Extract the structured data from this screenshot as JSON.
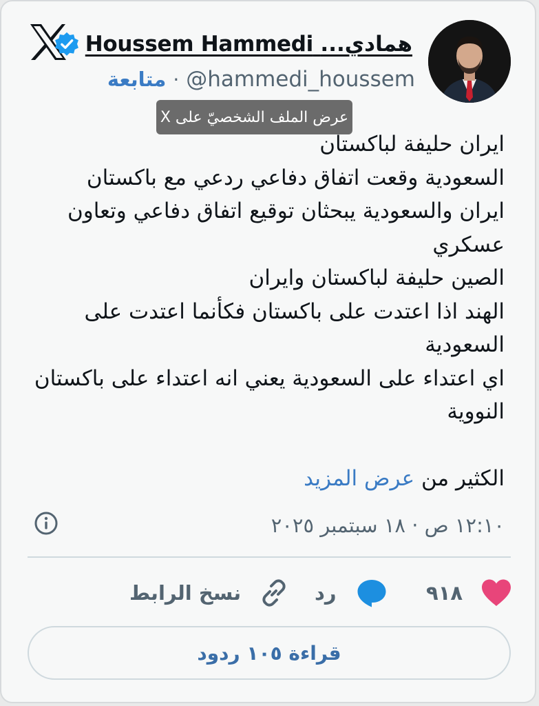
{
  "author": {
    "display_name": "Houssem Hammedi",
    "name_suffix": "همادي...",
    "handle": "@hammedi_houssem",
    "follow_label": "متابعة",
    "separator": "·",
    "verified": true
  },
  "tooltip": {
    "text": "عرض الملف الشخصيّ على X"
  },
  "tweet": {
    "lines": [
      "ايران حليفة لباكستان",
      "السعودية وقعت اتفاق دفاعي ردعي مع باكستان",
      "ايران والسعودية يبحثان توقيع اتفاق دفاعي وتعاون",
      "عسكري",
      "الصين حليفة لباكستان وايران",
      "الهند اذا اعتدت على باكستان فكأنما اعتدت على",
      "السعودية",
      "اي اعتداء على السعودية يعني انه اعتداء على باكستان",
      "النووية"
    ],
    "more_prefix": "الكثير من",
    "more_link": "عرض المزيد",
    "timestamp": "١٢:١٠ ص · ١٨ سبتمبر ٢٠٢٥"
  },
  "actions": {
    "like_count": "٩١٨",
    "reply_label": "رد",
    "copy_link_label": "نسخ الرابط"
  },
  "read_replies_label": "قراءة ١٠٥ ردود",
  "icons": {
    "logo": "x-logo-icon",
    "verified": "verified-badge-icon",
    "info": "info-icon",
    "like": "heart-icon",
    "reply": "speech-bubble-icon",
    "copy_link": "link-icon"
  },
  "colors": {
    "link_blue": "#3a7bc4",
    "verified_blue": "#1d9bf0",
    "heart_pink": "#e8457a",
    "text_primary": "#0f1419",
    "text_secondary": "#536471"
  }
}
